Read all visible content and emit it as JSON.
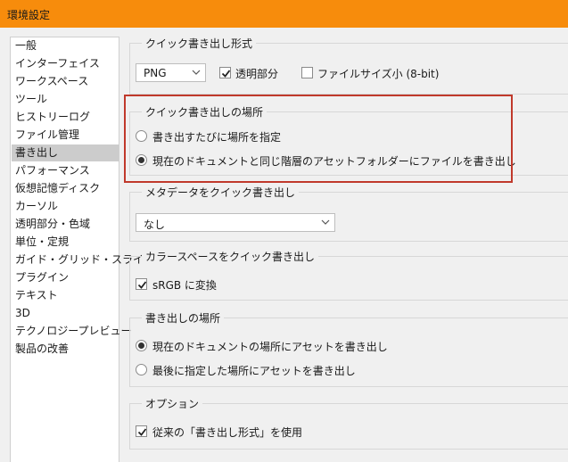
{
  "window": {
    "title": "環境設定"
  },
  "sidebar": {
    "items": [
      {
        "label": "一般"
      },
      {
        "label": "インターフェイス"
      },
      {
        "label": "ワークスペース"
      },
      {
        "label": "ツール"
      },
      {
        "label": "ヒストリーログ"
      },
      {
        "label": "ファイル管理"
      },
      {
        "label": "書き出し"
      },
      {
        "label": "パフォーマンス"
      },
      {
        "label": "仮想記憶ディスク"
      },
      {
        "label": "カーソル"
      },
      {
        "label": "透明部分・色域"
      },
      {
        "label": "単位・定規"
      },
      {
        "label": "ガイド・グリッド・スライス"
      },
      {
        "label": "プラグイン"
      },
      {
        "label": "テキスト"
      },
      {
        "label": "3D"
      },
      {
        "label": "テクノロジープレビュー"
      },
      {
        "label": "製品の改善"
      }
    ],
    "selected": "書き出し"
  },
  "quick_export_format": {
    "title": "クイック書き出し形式",
    "format_value": "PNG",
    "transparency_label": "透明部分",
    "transparency_checked": true,
    "small_file_label": "ファイルサイズ小 (8-bit)",
    "small_file_checked": false
  },
  "quick_export_location": {
    "title": "クイック書き出しの場所",
    "option_ask": "書き出すたびに場所を指定",
    "option_assets_folder": "現在のドキュメントと同じ階層のアセットフォルダーにファイルを書き出し",
    "selected": "option_assets_folder"
  },
  "quick_export_metadata": {
    "title": "メタデータをクイック書き出し",
    "value": "なし"
  },
  "quick_export_colorspace": {
    "title": "カラースペースをクイック書き出し",
    "srgb_label": "sRGB に変換",
    "srgb_checked": true
  },
  "export_location": {
    "title": "書き出しの場所",
    "option_current_doc": "現在のドキュメントの場所にアセットを書き出し",
    "option_last_used": "最後に指定した場所にアセットを書き出し",
    "selected": "option_current_doc"
  },
  "options": {
    "title": "オプション",
    "legacy_label": "従来の「書き出し形式」を使用",
    "legacy_checked": true
  },
  "colors": {
    "titlebar": "#f78c0c",
    "highlight_border": "#c0392b",
    "selected_item": "#cccccc"
  }
}
